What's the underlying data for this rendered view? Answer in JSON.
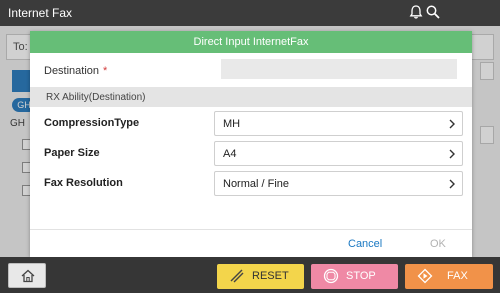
{
  "app": {
    "title": "Internet  Fax"
  },
  "background": {
    "to_label": "To:",
    "pill_label": "GH",
    "list_head": "GH"
  },
  "dialog": {
    "title": "Direct  Input  InternetFax",
    "destination_label": "Destination",
    "required_mark": "*",
    "destination_value": "",
    "section_title": "RX  Ability(Destination)",
    "settings": [
      {
        "label": "CompressionType",
        "value": "MH"
      },
      {
        "label": "Paper  Size",
        "value": "A4"
      },
      {
        "label": "Fax  Resolution",
        "value": "Normal  /  Fine"
      }
    ],
    "cancel_label": "Cancel",
    "ok_label": "OK"
  },
  "bottom": {
    "reset_label": "RESET",
    "stop_label": "STOP",
    "fax_label": "FAX"
  },
  "colors": {
    "dialog_header": "#66be77",
    "reset": "#f3d54b",
    "stop": "#ef89a5",
    "fax": "#f19249",
    "link": "#1a78c2"
  }
}
